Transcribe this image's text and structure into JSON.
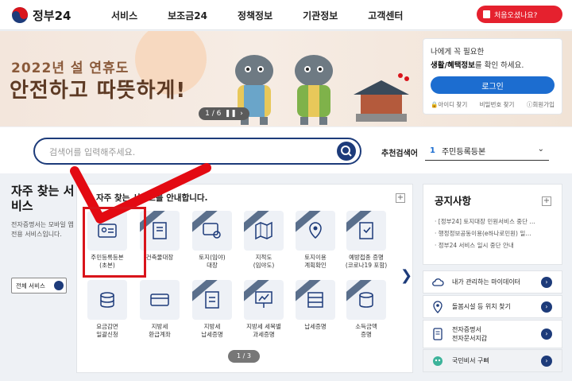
{
  "header": {
    "logo_text": "정부24",
    "nav": [
      "서비스",
      "보조금24",
      "정책정보",
      "기관정보",
      "고객센터"
    ],
    "first_visit_button": "처음오셨나요?"
  },
  "banner": {
    "line1": "2022년 설 연휴도",
    "line2": "안전하고 따뜻하게!",
    "pager": "1 / 6"
  },
  "login_card": {
    "line1": "나에게 꼭 필요한",
    "line2_bold": "생활/혜택정보",
    "line2_rest": "를 확인 하세요.",
    "login_button": "로그인",
    "links": [
      "아이디 찾기",
      "비밀번호 찾기",
      "회원가입"
    ]
  },
  "search": {
    "placeholder": "검색어를 입력해주세요.",
    "recommend_label": "추천검색어",
    "recommend_number": "1",
    "recommend_value": "주민등록등본"
  },
  "frequent": {
    "heading": "자주 찾는 서비스",
    "description": "전자증명서는 모바일 앱 전용 서비스입니다.",
    "all_button": "전체 서비스"
  },
  "center": {
    "title": "자주 찾는 서비스를 안내합니다.",
    "pager": "1 / 3",
    "services": [
      {
        "line1": "주민등록등본",
        "line2": "(초본)"
      },
      {
        "line1": "건축물대장",
        "line2": ""
      },
      {
        "line1": "토지(임야)",
        "line2": "대장"
      },
      {
        "line1": "지적도",
        "line2": "(임야도)"
      },
      {
        "line1": "토지이용",
        "line2": "계획확인"
      },
      {
        "line1": "예방접종 증명",
        "line2": "(코로나19 포함)"
      },
      {
        "line1": "요금감면",
        "line2": "일괄신청"
      },
      {
        "line1": "지방세",
        "line2": "환급계좌"
      },
      {
        "line1": "지방세",
        "line2": "납세증명"
      },
      {
        "line1": "지방세 세목별",
        "line2": "과세증명"
      },
      {
        "line1": "납세증명",
        "line2": ""
      },
      {
        "line1": "소득금액",
        "line2": "증명"
      }
    ]
  },
  "notice": {
    "heading": "공지사항",
    "items": [
      "[정부24] 토지대장 민원서비스 중단 …",
      "행정정보공동이용(e하나로민원) 일…",
      "정부24 서비스 일시 중단 안내"
    ]
  },
  "quick_links": [
    {
      "line1": "내가 관리하는 마이데이터",
      "line2": ""
    },
    {
      "line1": "돌봄시설 등 위치 찾기",
      "line2": ""
    },
    {
      "line1": "전자증명서",
      "line2": "전자문서지갑"
    },
    {
      "line1": "국민비서 구삐",
      "line2": ""
    }
  ]
}
